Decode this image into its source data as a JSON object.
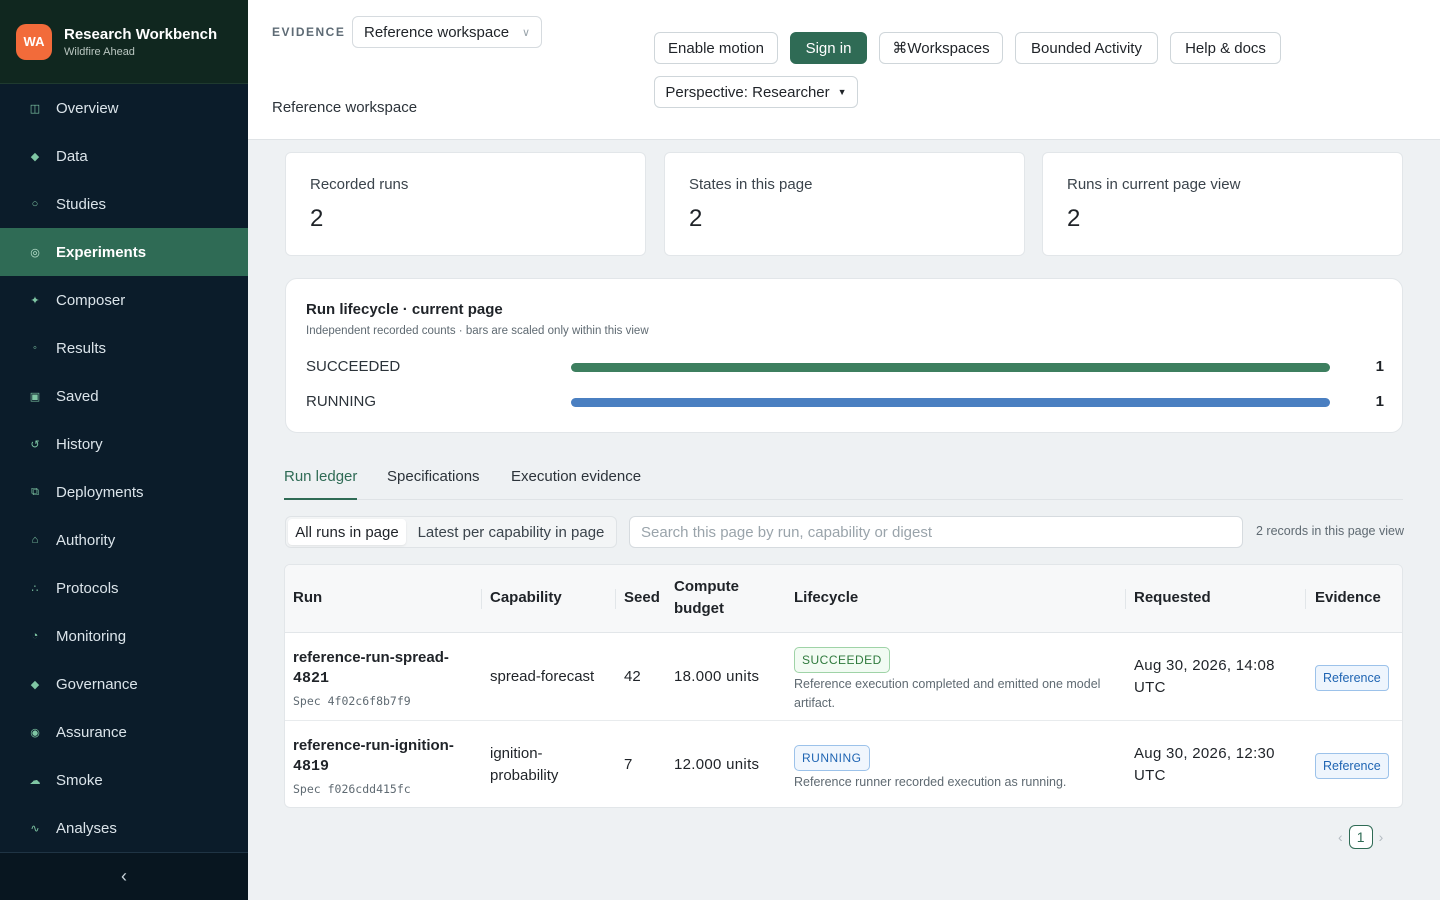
{
  "app": {
    "logo_initials": "WA",
    "title": "Research Workbench",
    "subtitle": "Wildfire Ahead"
  },
  "sidebar": {
    "items": [
      {
        "label": "Overview",
        "icon": "◫"
      },
      {
        "label": "Data",
        "icon": "◆"
      },
      {
        "label": "Studies",
        "icon": "○"
      },
      {
        "label": "Experiments",
        "icon": "◎"
      },
      {
        "label": "Composer",
        "icon": "✦"
      },
      {
        "label": "Results",
        "icon": "◦"
      },
      {
        "label": "Saved",
        "icon": "▣"
      },
      {
        "label": "History",
        "icon": "↺"
      },
      {
        "label": "Deployments",
        "icon": "⧉"
      },
      {
        "label": "Authority",
        "icon": "⌂"
      },
      {
        "label": "Protocols",
        "icon": "∴"
      },
      {
        "label": "Monitoring",
        "icon": "◔"
      },
      {
        "label": "Governance",
        "icon": "◆"
      },
      {
        "label": "Assurance",
        "icon": "◉"
      },
      {
        "label": "Smoke",
        "icon": "☁"
      },
      {
        "label": "Analyses",
        "icon": "∿"
      }
    ],
    "active_index": 3,
    "collapse_glyph": "‹"
  },
  "header": {
    "evidence_label": "EVIDENCE",
    "workspace_select": "Reference workspace",
    "workspace_caption": "Reference workspace",
    "buttons": {
      "enable_motion": "Enable motion",
      "sign_in": "Sign in",
      "workspaces": "⌘Workspaces",
      "bounded_activity": "Bounded Activity",
      "help": "Help & docs",
      "perspective": "Perspective: Researcher"
    }
  },
  "stats": [
    {
      "label": "Recorded runs",
      "value": "2"
    },
    {
      "label": "States in this page",
      "value": "2"
    },
    {
      "label": "Runs in current page view",
      "value": "2"
    }
  ],
  "lifecycle": {
    "title": "Run lifecycle · current page",
    "subtitle": "Independent recorded counts · bars are scaled only within this view",
    "rows": [
      {
        "state": "SUCCEEDED",
        "count": "1",
        "fraction": 1.0,
        "color": "#3d7f5f"
      },
      {
        "state": "RUNNING",
        "count": "1",
        "fraction": 1.0,
        "color": "#4a7fc1"
      }
    ]
  },
  "tabs": [
    "Run ledger",
    "Specifications",
    "Execution evidence"
  ],
  "filters": {
    "seg_all": "All runs in page",
    "seg_latest": "Latest per capability in page",
    "search_placeholder": "Search this page by run, capability or digest",
    "record_count": "2 records in this page view"
  },
  "table": {
    "columns": {
      "run": "Run",
      "capability": "Capability",
      "seed": "Seed",
      "budget_1": "Compute",
      "budget_2": "budget",
      "lifecycle": "Lifecycle",
      "requested": "Requested",
      "evidence": "Evidence"
    },
    "rows": [
      {
        "run_1": "reference-run-spread-",
        "run_2": "4821",
        "spec": "Spec 4f02c6f8b7f9",
        "capability_1": "spread-forecast",
        "capability_2": "",
        "seed": "42",
        "budget": "18.000 units",
        "status": "SUCCEEDED",
        "status_desc": "Reference execution completed and emitted one model artifact.",
        "requested_1": "Aug 30, 2026, 14:08",
        "requested_2": "UTC",
        "evidence": "Reference"
      },
      {
        "run_1": "reference-run-ignition-",
        "run_2": "4819",
        "spec": "Spec f026cdd415fc",
        "capability_1": "ignition-",
        "capability_2": "probability",
        "seed": "7",
        "budget": "12.000 units",
        "status": "RUNNING",
        "status_desc": "Reference runner recorded execution as running.",
        "requested_1": "Aug 30, 2026, 12:30",
        "requested_2": "UTC",
        "evidence": "Reference"
      }
    ]
  },
  "pagination": {
    "prev": "‹",
    "page": "1",
    "next": "›"
  }
}
